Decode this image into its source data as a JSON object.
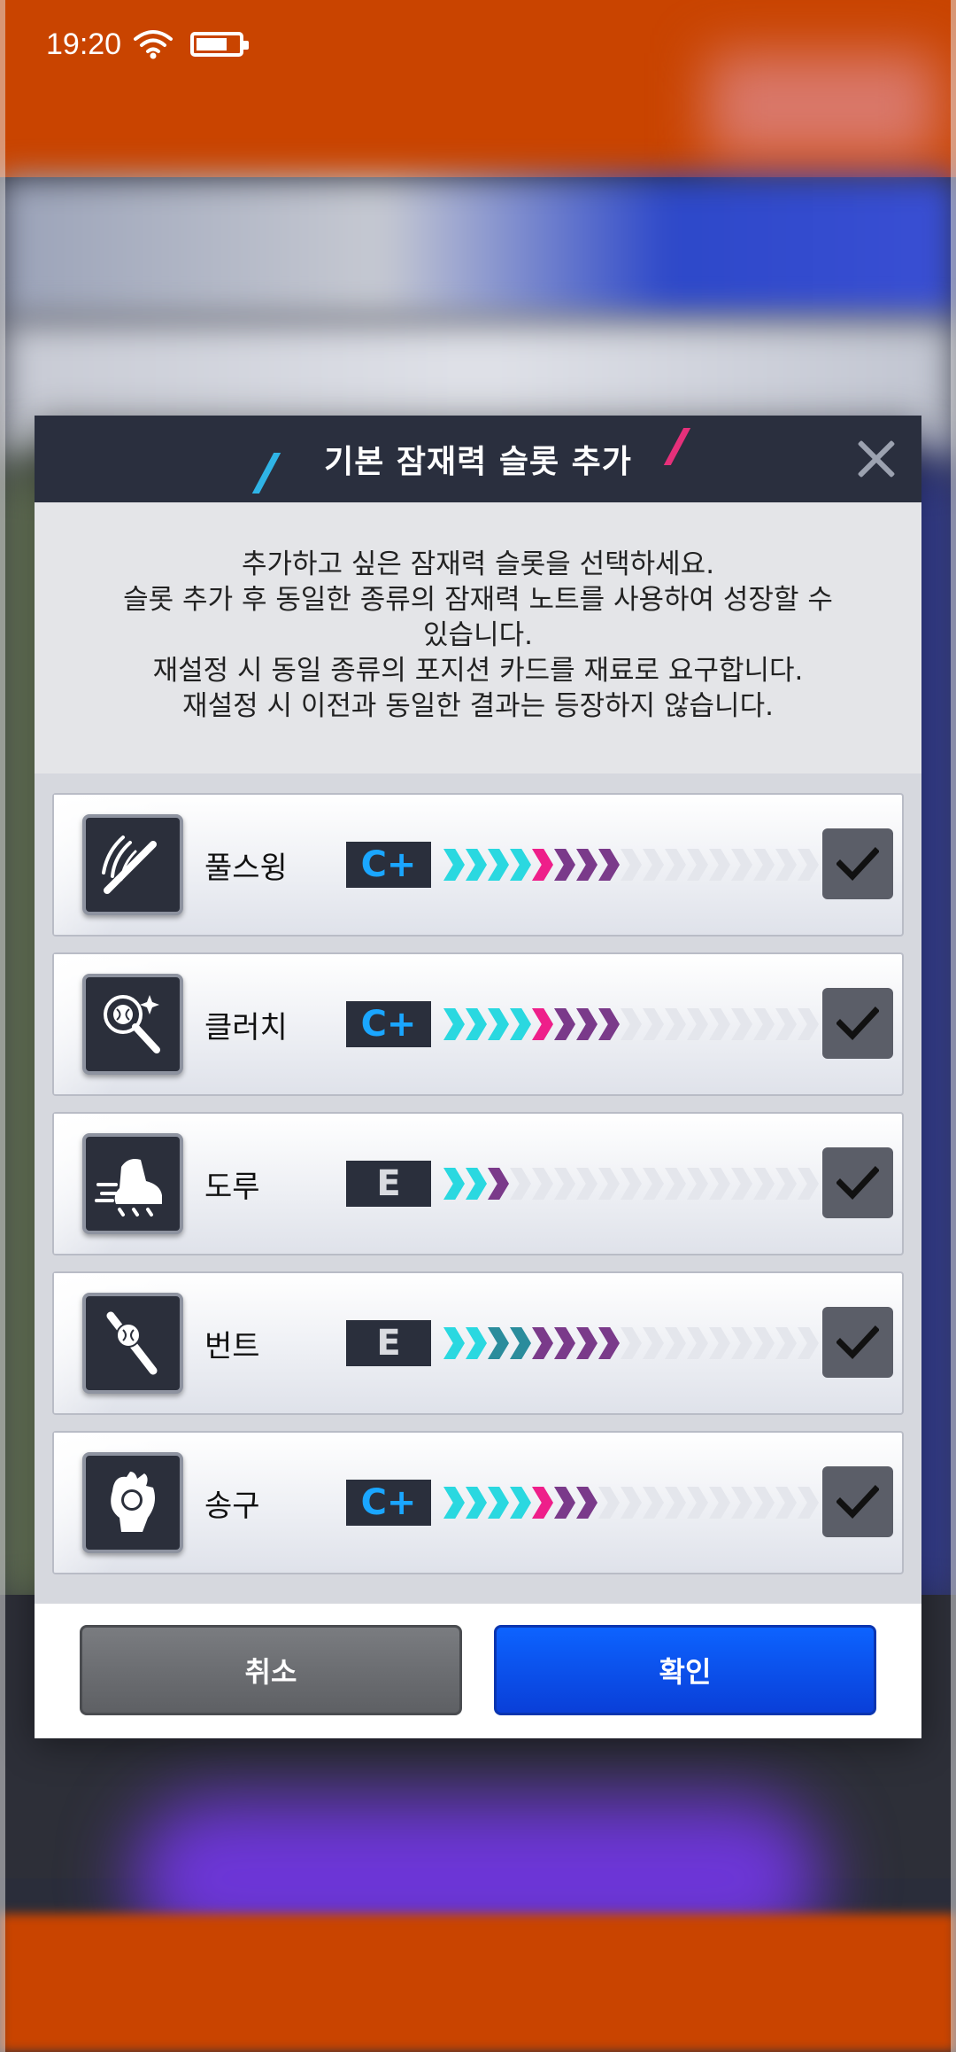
{
  "status_bar": {
    "time": "19:20"
  },
  "dialog": {
    "title": "기본 잠재력 슬롯 추가",
    "description": "추가하고 싶은 잠재력 슬롯을 선택하세요.\n슬롯 추가 후 동일한 종류의 잠재력 노트를 사용하여 성장할 수\n있습니다.\n재설정 시 동일 종류의 포지션 카드를 재료로 요구합니다.\n재설정 시 이전과 동일한 결과는 등장하지 않습니다.",
    "slots": [
      {
        "name": "풀스윙",
        "grade": "C+",
        "icon": "full-swing-icon",
        "bar": [
          "c",
          "c",
          "c",
          "c",
          "p",
          "d",
          "d",
          "d",
          "e",
          "e",
          "e",
          "e",
          "e",
          "e",
          "e",
          "e",
          "e"
        ],
        "checked": true
      },
      {
        "name": "클러치",
        "grade": "C+",
        "icon": "clutch-icon",
        "bar": [
          "c",
          "c",
          "c",
          "c",
          "p",
          "d",
          "d",
          "d",
          "e",
          "e",
          "e",
          "e",
          "e",
          "e",
          "e",
          "e",
          "e"
        ],
        "checked": true
      },
      {
        "name": "도루",
        "grade": "E",
        "icon": "steal-icon",
        "bar": [
          "c",
          "c",
          "d",
          "e",
          "e",
          "e",
          "e",
          "e",
          "e",
          "e",
          "e",
          "e",
          "e",
          "e",
          "e",
          "e",
          "e"
        ],
        "checked": true
      },
      {
        "name": "번트",
        "grade": "E",
        "icon": "bunt-icon",
        "bar": [
          "c",
          "c",
          "t",
          "t",
          "d",
          "d",
          "d",
          "d",
          "e",
          "e",
          "e",
          "e",
          "e",
          "e",
          "e",
          "e",
          "e"
        ],
        "checked": true
      },
      {
        "name": "송구",
        "grade": "C+",
        "icon": "throw-icon",
        "bar": [
          "c",
          "c",
          "c",
          "c",
          "p",
          "d",
          "d",
          "e",
          "e",
          "e",
          "e",
          "e",
          "e",
          "e",
          "e",
          "e",
          "e"
        ],
        "checked": true
      }
    ],
    "buttons": {
      "cancel": "취소",
      "confirm": "확인"
    }
  },
  "colors": {
    "bar_cyan": "#2ad8e0",
    "bar_teal": "#2a8c9c",
    "bar_pink": "#ee1f8a",
    "bar_purple": "#7a3a8a",
    "bar_empty": "#e4e6ec",
    "grade_cplus": "#1aa6ff",
    "grade_e": "#d9dbe0",
    "confirm_button": "#0d55f0",
    "cancel_button": "#6a6c70"
  }
}
